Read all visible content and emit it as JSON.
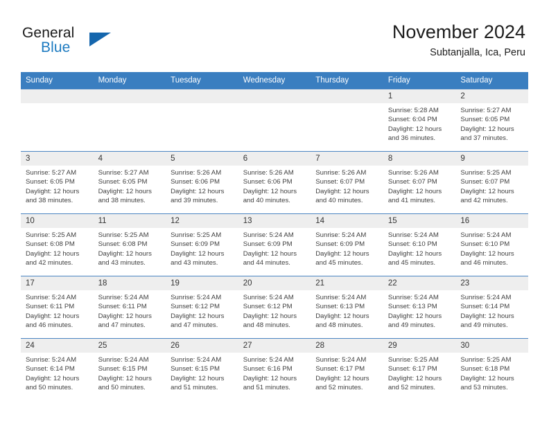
{
  "brand": {
    "name_part1": "General",
    "name_part2": "Blue",
    "logo_icon": "triangle-logo-icon",
    "accent_color": "#1566ad",
    "text_color": "#1c7ac0"
  },
  "header": {
    "month_title": "November 2024",
    "location": "Subtanjalla, Ica, Peru"
  },
  "calendar": {
    "header_bg": "#3a7ec0",
    "daynum_bg": "#eeeeee",
    "row_border": "#4a85c2",
    "weekdays": [
      "Sunday",
      "Monday",
      "Tuesday",
      "Wednesday",
      "Thursday",
      "Friday",
      "Saturday"
    ],
    "labels": {
      "sunrise": "Sunrise:",
      "sunset": "Sunset:",
      "daylight": "Daylight:"
    },
    "weeks": [
      [
        {
          "day": "",
          "empty": true
        },
        {
          "day": "",
          "empty": true
        },
        {
          "day": "",
          "empty": true
        },
        {
          "day": "",
          "empty": true
        },
        {
          "day": "",
          "empty": true
        },
        {
          "day": "1",
          "sunrise": "Sunrise: 5:28 AM",
          "sunset": "Sunset: 6:04 PM",
          "daylight1": "Daylight: 12 hours",
          "daylight2": "and 36 minutes."
        },
        {
          "day": "2",
          "sunrise": "Sunrise: 5:27 AM",
          "sunset": "Sunset: 6:05 PM",
          "daylight1": "Daylight: 12 hours",
          "daylight2": "and 37 minutes."
        }
      ],
      [
        {
          "day": "3",
          "sunrise": "Sunrise: 5:27 AM",
          "sunset": "Sunset: 6:05 PM",
          "daylight1": "Daylight: 12 hours",
          "daylight2": "and 38 minutes."
        },
        {
          "day": "4",
          "sunrise": "Sunrise: 5:27 AM",
          "sunset": "Sunset: 6:05 PM",
          "daylight1": "Daylight: 12 hours",
          "daylight2": "and 38 minutes."
        },
        {
          "day": "5",
          "sunrise": "Sunrise: 5:26 AM",
          "sunset": "Sunset: 6:06 PM",
          "daylight1": "Daylight: 12 hours",
          "daylight2": "and 39 minutes."
        },
        {
          "day": "6",
          "sunrise": "Sunrise: 5:26 AM",
          "sunset": "Sunset: 6:06 PM",
          "daylight1": "Daylight: 12 hours",
          "daylight2": "and 40 minutes."
        },
        {
          "day": "7",
          "sunrise": "Sunrise: 5:26 AM",
          "sunset": "Sunset: 6:07 PM",
          "daylight1": "Daylight: 12 hours",
          "daylight2": "and 40 minutes."
        },
        {
          "day": "8",
          "sunrise": "Sunrise: 5:26 AM",
          "sunset": "Sunset: 6:07 PM",
          "daylight1": "Daylight: 12 hours",
          "daylight2": "and 41 minutes."
        },
        {
          "day": "9",
          "sunrise": "Sunrise: 5:25 AM",
          "sunset": "Sunset: 6:07 PM",
          "daylight1": "Daylight: 12 hours",
          "daylight2": "and 42 minutes."
        }
      ],
      [
        {
          "day": "10",
          "sunrise": "Sunrise: 5:25 AM",
          "sunset": "Sunset: 6:08 PM",
          "daylight1": "Daylight: 12 hours",
          "daylight2": "and 42 minutes."
        },
        {
          "day": "11",
          "sunrise": "Sunrise: 5:25 AM",
          "sunset": "Sunset: 6:08 PM",
          "daylight1": "Daylight: 12 hours",
          "daylight2": "and 43 minutes."
        },
        {
          "day": "12",
          "sunrise": "Sunrise: 5:25 AM",
          "sunset": "Sunset: 6:09 PM",
          "daylight1": "Daylight: 12 hours",
          "daylight2": "and 43 minutes."
        },
        {
          "day": "13",
          "sunrise": "Sunrise: 5:24 AM",
          "sunset": "Sunset: 6:09 PM",
          "daylight1": "Daylight: 12 hours",
          "daylight2": "and 44 minutes."
        },
        {
          "day": "14",
          "sunrise": "Sunrise: 5:24 AM",
          "sunset": "Sunset: 6:09 PM",
          "daylight1": "Daylight: 12 hours",
          "daylight2": "and 45 minutes."
        },
        {
          "day": "15",
          "sunrise": "Sunrise: 5:24 AM",
          "sunset": "Sunset: 6:10 PM",
          "daylight1": "Daylight: 12 hours",
          "daylight2": "and 45 minutes."
        },
        {
          "day": "16",
          "sunrise": "Sunrise: 5:24 AM",
          "sunset": "Sunset: 6:10 PM",
          "daylight1": "Daylight: 12 hours",
          "daylight2": "and 46 minutes."
        }
      ],
      [
        {
          "day": "17",
          "sunrise": "Sunrise: 5:24 AM",
          "sunset": "Sunset: 6:11 PM",
          "daylight1": "Daylight: 12 hours",
          "daylight2": "and 46 minutes."
        },
        {
          "day": "18",
          "sunrise": "Sunrise: 5:24 AM",
          "sunset": "Sunset: 6:11 PM",
          "daylight1": "Daylight: 12 hours",
          "daylight2": "and 47 minutes."
        },
        {
          "day": "19",
          "sunrise": "Sunrise: 5:24 AM",
          "sunset": "Sunset: 6:12 PM",
          "daylight1": "Daylight: 12 hours",
          "daylight2": "and 47 minutes."
        },
        {
          "day": "20",
          "sunrise": "Sunrise: 5:24 AM",
          "sunset": "Sunset: 6:12 PM",
          "daylight1": "Daylight: 12 hours",
          "daylight2": "and 48 minutes."
        },
        {
          "day": "21",
          "sunrise": "Sunrise: 5:24 AM",
          "sunset": "Sunset: 6:13 PM",
          "daylight1": "Daylight: 12 hours",
          "daylight2": "and 48 minutes."
        },
        {
          "day": "22",
          "sunrise": "Sunrise: 5:24 AM",
          "sunset": "Sunset: 6:13 PM",
          "daylight1": "Daylight: 12 hours",
          "daylight2": "and 49 minutes."
        },
        {
          "day": "23",
          "sunrise": "Sunrise: 5:24 AM",
          "sunset": "Sunset: 6:14 PM",
          "daylight1": "Daylight: 12 hours",
          "daylight2": "and 49 minutes."
        }
      ],
      [
        {
          "day": "24",
          "sunrise": "Sunrise: 5:24 AM",
          "sunset": "Sunset: 6:14 PM",
          "daylight1": "Daylight: 12 hours",
          "daylight2": "and 50 minutes."
        },
        {
          "day": "25",
          "sunrise": "Sunrise: 5:24 AM",
          "sunset": "Sunset: 6:15 PM",
          "daylight1": "Daylight: 12 hours",
          "daylight2": "and 50 minutes."
        },
        {
          "day": "26",
          "sunrise": "Sunrise: 5:24 AM",
          "sunset": "Sunset: 6:15 PM",
          "daylight1": "Daylight: 12 hours",
          "daylight2": "and 51 minutes."
        },
        {
          "day": "27",
          "sunrise": "Sunrise: 5:24 AM",
          "sunset": "Sunset: 6:16 PM",
          "daylight1": "Daylight: 12 hours",
          "daylight2": "and 51 minutes."
        },
        {
          "day": "28",
          "sunrise": "Sunrise: 5:24 AM",
          "sunset": "Sunset: 6:17 PM",
          "daylight1": "Daylight: 12 hours",
          "daylight2": "and 52 minutes."
        },
        {
          "day": "29",
          "sunrise": "Sunrise: 5:25 AM",
          "sunset": "Sunset: 6:17 PM",
          "daylight1": "Daylight: 12 hours",
          "daylight2": "and 52 minutes."
        },
        {
          "day": "30",
          "sunrise": "Sunrise: 5:25 AM",
          "sunset": "Sunset: 6:18 PM",
          "daylight1": "Daylight: 12 hours",
          "daylight2": "and 53 minutes."
        }
      ]
    ]
  }
}
